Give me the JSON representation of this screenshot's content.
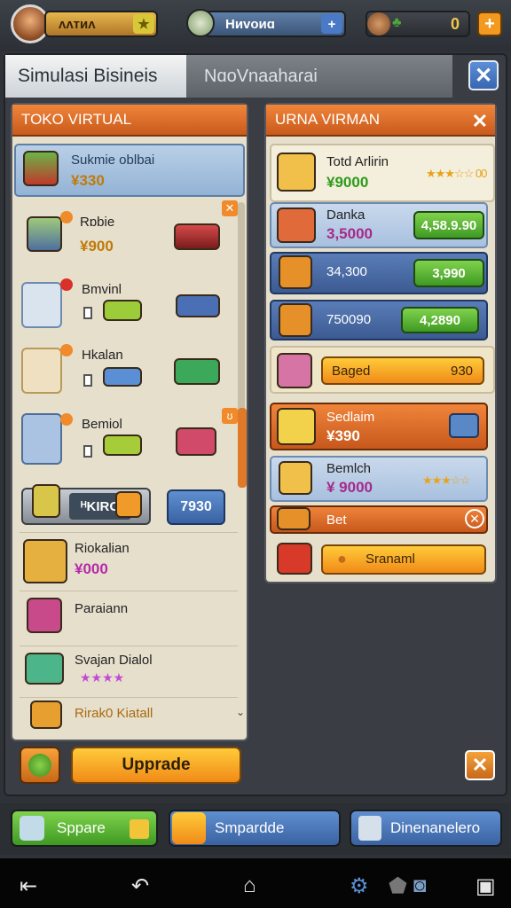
{
  "topbar": {
    "coins_label": "ᴧᴧᴛᴎᴧ",
    "gems_label": "Hᴎvᴏᴎɑ",
    "counter_value": "0"
  },
  "window": {
    "title": "Simulasi Bisineis",
    "tab2": "NɑoVnaahaɾai",
    "close": "✕"
  },
  "left": {
    "header": "TOKO VIRTUAL",
    "items": [
      {
        "name": "Sukmie oblbai",
        "price": "¥330"
      },
      {
        "name": "Rɒbie",
        "price": "¥900"
      },
      {
        "name": "Bmvinl",
        "price": ""
      },
      {
        "name": "Hkalan",
        "price": ""
      },
      {
        "name": "Bemiol",
        "price": ""
      },
      {
        "name": "Riokalian",
        "price": "¥000"
      },
      {
        "name": "Paraiann",
        "price": ""
      },
      {
        "name": "Svajan Dialol",
        "price": ""
      },
      {
        "name": "Rirak0 Kiatall",
        "price": ""
      }
    ],
    "wide_label": "ᴴKIRO",
    "wide_value": "7930",
    "upgrade": "Upprade"
  },
  "right": {
    "header": "URNA VIRMAN",
    "rows": [
      {
        "name": "Totd Arlirin",
        "value": "¥9000",
        "stars": "★★★☆☆ 00"
      },
      {
        "name": "Danka",
        "value": "3,5000",
        "btn": "4,58.9.90"
      },
      {
        "name": "34,300",
        "value": "",
        "btn": "3,990"
      },
      {
        "name": "750090",
        "value": "",
        "btn": "4,2890"
      },
      {
        "name": "Baged",
        "value": "",
        "btn": "930"
      },
      {
        "name": "Sedlaim",
        "value": "¥390"
      },
      {
        "name": "Bemlch",
        "value": "¥ 9000",
        "stars": "★★★☆☆"
      },
      {
        "name": "Bet",
        "value": ""
      },
      {
        "name": "Sranaml",
        "value": ""
      }
    ]
  },
  "bottom": {
    "b1": "Sppare",
    "b2": "Smpardde",
    "b3": "Dinenanelero"
  },
  "colors": {
    "orange": "#e26e26",
    "green": "#4cae2c",
    "blue": "#4e73b0"
  }
}
